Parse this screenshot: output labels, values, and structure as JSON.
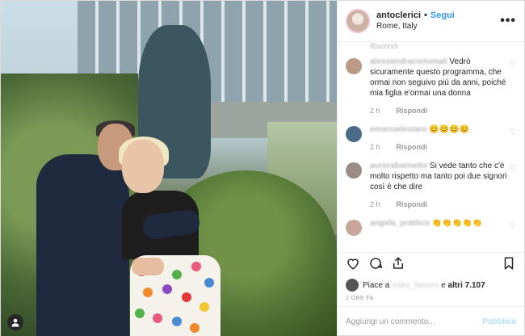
{
  "header": {
    "username": "antoclerici",
    "separator": "•",
    "follow_label": "Segui",
    "location": "Rome, Italy",
    "more_label": "•••"
  },
  "comments": {
    "previous_reply_partial": "Rispondi",
    "items": [
      {
        "user": "alessandraciolomail",
        "text": "Vedrò sicuramente questo programma, che ormai non seguivo più da anni, poiché mia figlia e'ormai una donna",
        "time": "2 h",
        "reply": "Rispondi",
        "avatar_color": "#b89a86"
      },
      {
        "user": "emanuelestaro",
        "text": "😊😊😊😊",
        "time": "2 h",
        "reply": "Rispondi",
        "avatar_color": "#4a6a87"
      },
      {
        "user": "aurorabarnetto",
        "text": "Si vede tanto che c'è molto rispetto ma tanto poi due signori così è che dire",
        "time": "2 h",
        "reply": "Rispondi",
        "avatar_color": "#9a8d88"
      },
      {
        "user": "angela_prattico",
        "text": "👏👏👏👏👏",
        "time": "",
        "reply": "",
        "avatar_color": "#c7a79a"
      }
    ]
  },
  "likes": {
    "prefix": "Piace a",
    "user": "mary_fiavore",
    "connector": "e",
    "others": "altri 7.107"
  },
  "timestamp": "2 ORE FA",
  "add_comment": {
    "placeholder": "Aggiungi un commento...",
    "publish": "Pubblica"
  },
  "colors": {
    "link_blue": "#3897f0",
    "publish_disabled": "#b2dffc",
    "border": "#efefef"
  },
  "icons": [
    "heart-icon",
    "comment-icon",
    "share-icon",
    "bookmark-icon",
    "user-tag-icon"
  ]
}
